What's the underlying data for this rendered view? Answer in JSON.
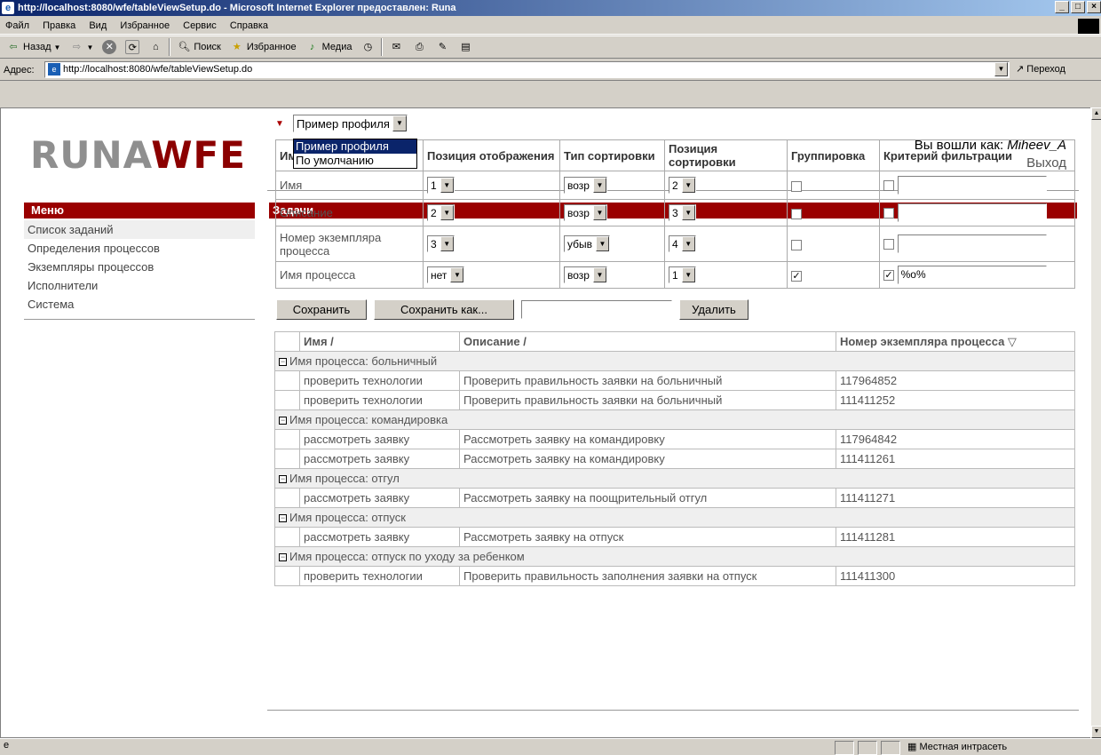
{
  "window": {
    "title": "http://localhost:8080/wfe/tableViewSetup.do - Microsoft Internet Explorer предоставлен: Runa"
  },
  "menu": [
    "Файл",
    "Правка",
    "Вид",
    "Избранное",
    "Сервис",
    "Справка"
  ],
  "toolbar": {
    "back": "Назад",
    "search": "Поиск",
    "favorites": "Избранное",
    "media": "Медиа"
  },
  "address": {
    "label": "Адрес:",
    "url": "http://localhost:8080/wfe/tableViewSetup.do",
    "go": "Переход"
  },
  "header": {
    "logo_gray": "RUNA",
    "logo_red": "WFE",
    "logged_in_label": "Вы вошли как:",
    "username": "Miheev_A",
    "logout": "Выход"
  },
  "sidebar": {
    "title": "Меню",
    "items": [
      "Список заданий",
      "Определения процессов",
      "Экземпляры процессов",
      "Исполнители",
      "Система"
    ]
  },
  "main": {
    "title": "Задачи",
    "profile_selected": "Пример профиля",
    "profile_options": [
      "Пример профиля",
      "По умолчанию"
    ]
  },
  "setup": {
    "headers": {
      "name": "Имя",
      "display_position": "Позиция отображения",
      "sort_type": "Тип сортировки",
      "sort_position": "Позиция сортировки",
      "grouping": "Группировка",
      "filter": "Критерий фильтрации"
    },
    "rows": [
      {
        "name": "Имя",
        "display": "1",
        "sort_type": "возр",
        "sort_pos": "2",
        "group": false,
        "filter_on": false,
        "filter": ""
      },
      {
        "name": "Описание",
        "display": "2",
        "sort_type": "возр",
        "sort_pos": "3",
        "group": false,
        "filter_on": false,
        "filter": ""
      },
      {
        "name": "Номер экземпляра процесса",
        "display": "3",
        "sort_type": "убыв",
        "sort_pos": "4",
        "group": false,
        "filter_on": false,
        "filter": ""
      },
      {
        "name": "Имя процесса",
        "display": "нет",
        "sort_type": "возр",
        "sort_pos": "1",
        "group": true,
        "filter_on": true,
        "filter": "%o%"
      }
    ],
    "buttons": {
      "save": "Сохранить",
      "save_as": "Сохранить как...",
      "delete": "Удалить"
    },
    "save_as_value": ""
  },
  "tasks": {
    "columns": [
      "Имя /",
      "Описание /",
      "Номер экземпляра процесса ▽"
    ],
    "groups": [
      {
        "label": "Имя процесса: больничный",
        "rows": [
          [
            "проверить технологии",
            "Проверить правильность заявки на больничный",
            "117964852"
          ],
          [
            "проверить технологии",
            "Проверить правильность заявки на больничный",
            "111411252"
          ]
        ]
      },
      {
        "label": "Имя процесса: командировка",
        "rows": [
          [
            "рассмотреть заявку",
            "Рассмотреть заявку на командировку",
            "117964842"
          ],
          [
            "рассмотреть заявку",
            "Рассмотреть заявку на командировку",
            "111411261"
          ]
        ]
      },
      {
        "label": "Имя процесса: отгул",
        "rows": [
          [
            "рассмотреть заявку",
            "Рассмотреть заявку на поощрительный отгул",
            "111411271"
          ]
        ]
      },
      {
        "label": "Имя процесса: отпуск",
        "rows": [
          [
            "рассмотреть заявку",
            "Рассмотреть заявку на отпуск",
            "111411281"
          ]
        ]
      },
      {
        "label": "Имя процесса: отпуск по уходу за ребенком",
        "rows": [
          [
            "проверить технологии",
            "Проверить правильность заполнения заявки на отпуск",
            "111411300"
          ]
        ]
      }
    ]
  },
  "status": {
    "zone": "Местная интрасеть"
  }
}
